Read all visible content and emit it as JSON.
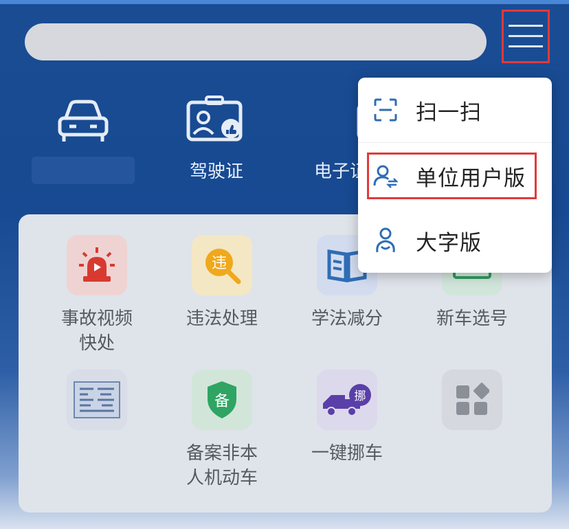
{
  "quick_access": {
    "items": [
      {
        "id": "car",
        "label": ""
      },
      {
        "id": "license",
        "label": "驾驶证"
      },
      {
        "id": "ecert",
        "label": "电子证件"
      }
    ]
  },
  "services": {
    "items": [
      {
        "label": "事故视频快处",
        "line1": "事故视频",
        "line2": "快处",
        "icon": "alarm-light-icon"
      },
      {
        "label": "违法处理",
        "line1": "违法处理",
        "line2": "",
        "icon": "violation-search-icon"
      },
      {
        "label": "学法减分",
        "line1": "学法减分",
        "line2": "",
        "icon": "open-book-icon"
      },
      {
        "label": "新车选号",
        "line1": "新车选号",
        "line2": "",
        "icon": "plate-icon"
      },
      {
        "label": "",
        "line1": "",
        "line2": "",
        "icon": "certificate-icon"
      },
      {
        "label": "备案非本人机动车",
        "line1": "备案非本",
        "line2": "人机动车",
        "icon": "shield-bei-icon",
        "glyph": "备"
      },
      {
        "label": "一键挪车",
        "line1": "一键挪车",
        "line2": "",
        "icon": "tow-truck-icon",
        "glyph": "挪"
      },
      {
        "label": "",
        "line1": "",
        "line2": "",
        "icon": "more-apps-icon"
      }
    ],
    "violation_glyph": "违"
  },
  "dropdown": {
    "items": [
      {
        "label": "扫一扫",
        "icon": "scan-icon"
      },
      {
        "label": "单位用户版",
        "icon": "user-switch-icon"
      },
      {
        "label": "大字版",
        "icon": "elder-mode-icon"
      }
    ]
  },
  "colors": {
    "accent_red": "#e03a3a",
    "header_blue": "#1a4c93",
    "icon_blue": "#2f6db5"
  }
}
